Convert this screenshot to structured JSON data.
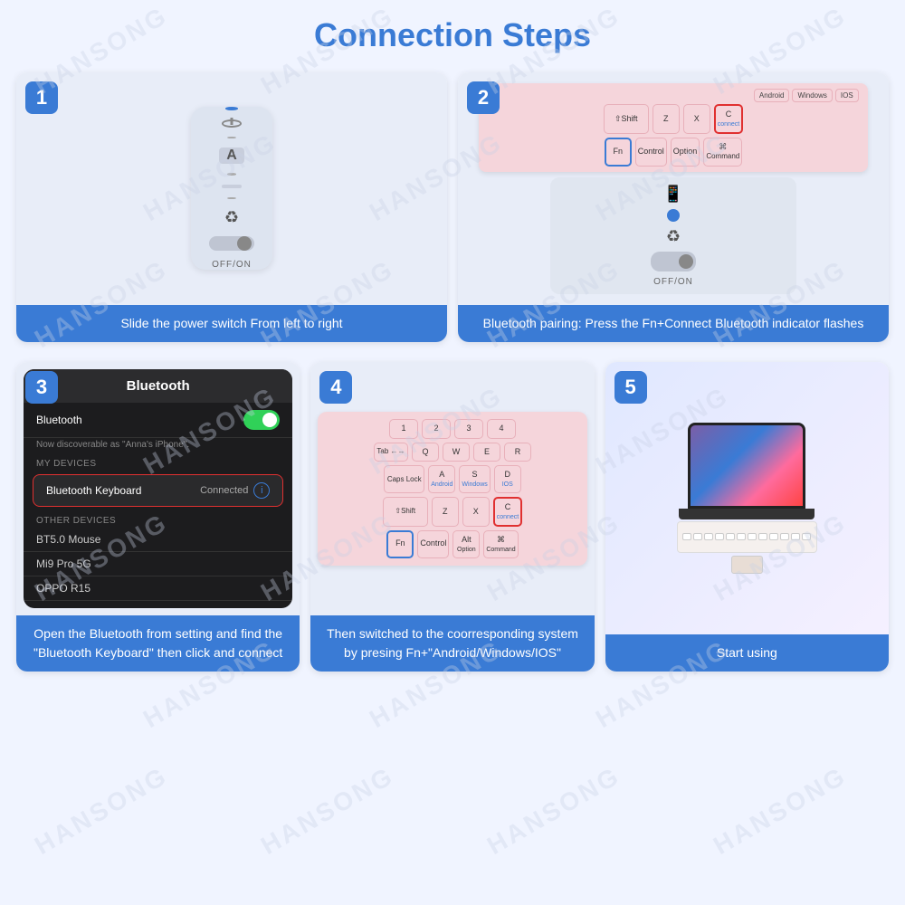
{
  "page": {
    "title": "Connection Steps",
    "watermark": "HANSONG"
  },
  "steps": [
    {
      "number": "1",
      "caption": "Slide the power switch\nFrom left to right"
    },
    {
      "number": "2",
      "caption": "Bluetooth pairing: Press the Fn+Connect\nBluetooth indicator flashes"
    },
    {
      "number": "3",
      "caption": "Open the Bluetooth from setting and find the \"Bluetooth Keyboard\" then click and connect"
    },
    {
      "number": "4",
      "caption": "Then switched to the coorresponding system by presing Fn+\"Android/Windows/IOS\""
    },
    {
      "number": "5",
      "caption": "Start using"
    }
  ],
  "bluetooth_ui": {
    "title": "Bluetooth",
    "bluetooth_label": "Bluetooth",
    "discoverable_text": "Now discoverable as \"Anna's iPhone\".",
    "my_devices_label": "MY DEVICES",
    "connected_device": "Bluetooth Keyboard",
    "connected_status": "Connected",
    "other_devices_label": "OTHER DEVICES",
    "other_devices": [
      "BT5.0 Mouse",
      "Mi9 Pro 5G",
      "OPPO R15"
    ]
  },
  "keyboard_step2": {
    "top_keys": [
      "Android",
      "Windows",
      "IOS"
    ],
    "row1": [
      "⇧Shift",
      "Z",
      "X",
      "C\nconnect"
    ],
    "row2": [
      "Fn",
      "Control",
      "Option",
      "Command"
    ]
  },
  "keyboard_step4": {
    "top_nums": [
      "1",
      "2",
      "3",
      "4"
    ],
    "row1": [
      "Q",
      "W",
      "E",
      "R"
    ],
    "row2": [
      "A",
      "S",
      "D"
    ],
    "row2_labels": [
      "Android",
      "Windows",
      "IOS"
    ],
    "row3": [
      "⇧Shift",
      "Z",
      "X",
      "C\nconnect"
    ],
    "row4": [
      "Fn",
      "Control",
      "Option",
      "Command"
    ],
    "caps_lock": "Caps Lock",
    "tab": "Tab ←→"
  }
}
